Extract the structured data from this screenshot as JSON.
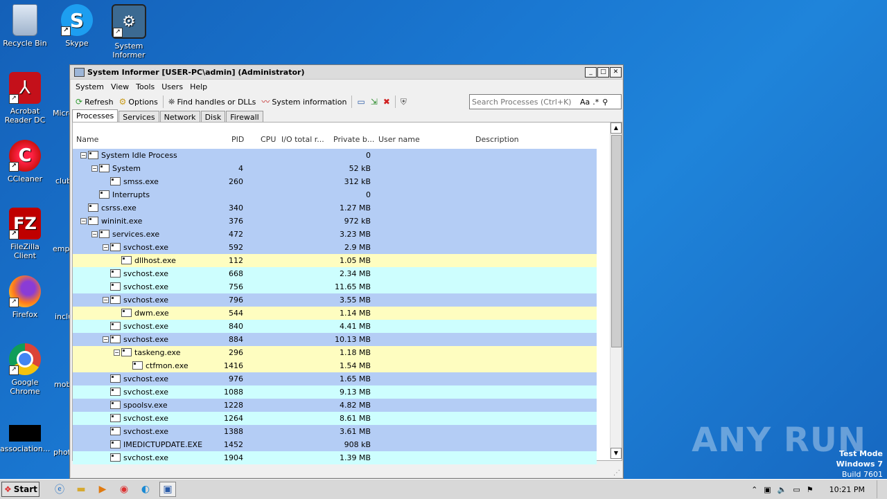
{
  "desktop": {
    "icons": [
      {
        "label": "Recycle Bin",
        "icon": "recycle-bin-icon"
      },
      {
        "label": "Skype",
        "icon": "skype-icon"
      },
      {
        "label": "System Informer",
        "icon": "system-informer-icon"
      },
      {
        "label": "Acrobat Reader DC",
        "icon": "acrobat-icon"
      },
      {
        "label": "CCleaner",
        "icon": "ccleaner-icon"
      },
      {
        "label": "FileZilla Client",
        "icon": "filezilla-icon"
      },
      {
        "label": "Firefox",
        "icon": "firefox-icon"
      },
      {
        "label": "Google Chrome",
        "icon": "chrome-icon"
      },
      {
        "label": "association...",
        "icon": "file-icon"
      }
    ],
    "partial_labels": [
      "Micro",
      "club",
      "emplo",
      "inclu",
      "mobi",
      "phot"
    ],
    "watermark": "ANY RUN",
    "test_mode": [
      "Test Mode",
      "Windows 7",
      "Build 7601"
    ]
  },
  "window": {
    "title": "System Informer [USER-PC\\admin] (Administrator)",
    "controls": {
      "minimize": "_",
      "maximize": "□",
      "close": "✕"
    },
    "menu": [
      "System",
      "View",
      "Tools",
      "Users",
      "Help"
    ],
    "toolbar": {
      "refresh": "Refresh",
      "options": "Options",
      "find_handles": "Find handles or DLLs",
      "system_info": "System information"
    },
    "search": {
      "placeholder": "Search Processes (Ctrl+K)",
      "case": "Aa",
      "regex": ".*"
    },
    "tabs": [
      "Processes",
      "Services",
      "Network",
      "Disk",
      "Firewall"
    ],
    "columns": {
      "name": "Name",
      "pid": "PID",
      "cpu": "CPU",
      "io": "I/O total r...",
      "private": "Private b...",
      "user": "User name",
      "description": "Description"
    },
    "processes": [
      {
        "name": "System Idle Process",
        "pid": "",
        "private": "0",
        "level": 0,
        "toggle": "−",
        "color": "blue"
      },
      {
        "name": "System",
        "pid": "4",
        "private": "52 kB",
        "level": 1,
        "toggle": "−",
        "color": "blue"
      },
      {
        "name": "smss.exe",
        "pid": "260",
        "private": "312 kB",
        "level": 2,
        "toggle": "",
        "color": "blue"
      },
      {
        "name": "Interrupts",
        "pid": "",
        "private": "0",
        "level": 1,
        "toggle": "",
        "color": "blue"
      },
      {
        "name": "csrss.exe",
        "pid": "340",
        "private": "1.27 MB",
        "level": 0,
        "toggle": "",
        "color": "blue"
      },
      {
        "name": "wininit.exe",
        "pid": "376",
        "private": "972 kB",
        "level": 0,
        "toggle": "−",
        "color": "blue"
      },
      {
        "name": "services.exe",
        "pid": "472",
        "private": "3.23 MB",
        "level": 1,
        "toggle": "−",
        "color": "blue"
      },
      {
        "name": "svchost.exe",
        "pid": "592",
        "private": "2.9 MB",
        "level": 2,
        "toggle": "−",
        "color": "blue"
      },
      {
        "name": "dllhost.exe",
        "pid": "112",
        "private": "1.05 MB",
        "level": 3,
        "toggle": "",
        "color": "yellow"
      },
      {
        "name": "svchost.exe",
        "pid": "668",
        "private": "2.34 MB",
        "level": 2,
        "toggle": "",
        "color": "cyan"
      },
      {
        "name": "svchost.exe",
        "pid": "756",
        "private": "11.65 MB",
        "level": 2,
        "toggle": "",
        "color": "cyan"
      },
      {
        "name": "svchost.exe",
        "pid": "796",
        "private": "3.55 MB",
        "level": 2,
        "toggle": "−",
        "color": "blue"
      },
      {
        "name": "dwm.exe",
        "pid": "544",
        "private": "1.14 MB",
        "level": 3,
        "toggle": "",
        "color": "yellow"
      },
      {
        "name": "svchost.exe",
        "pid": "840",
        "private": "4.41 MB",
        "level": 2,
        "toggle": "",
        "color": "cyan"
      },
      {
        "name": "svchost.exe",
        "pid": "884",
        "private": "10.13 MB",
        "level": 2,
        "toggle": "−",
        "color": "blue"
      },
      {
        "name": "taskeng.exe",
        "pid": "296",
        "private": "1.18 MB",
        "level": 3,
        "toggle": "−",
        "color": "yellow"
      },
      {
        "name": "ctfmon.exe",
        "pid": "1416",
        "private": "1.54 MB",
        "level": 4,
        "toggle": "",
        "color": "yellow"
      },
      {
        "name": "svchost.exe",
        "pid": "976",
        "private": "1.65 MB",
        "level": 2,
        "toggle": "",
        "color": "blue"
      },
      {
        "name": "svchost.exe",
        "pid": "1088",
        "private": "9.13 MB",
        "level": 2,
        "toggle": "",
        "color": "cyan"
      },
      {
        "name": "spoolsv.exe",
        "pid": "1228",
        "private": "4.82 MB",
        "level": 2,
        "toggle": "",
        "color": "blue"
      },
      {
        "name": "svchost.exe",
        "pid": "1264",
        "private": "8.61 MB",
        "level": 2,
        "toggle": "",
        "color": "cyan"
      },
      {
        "name": "svchost.exe",
        "pid": "1388",
        "private": "3.61 MB",
        "level": 2,
        "toggle": "",
        "color": "blue"
      },
      {
        "name": "IMEDICTUPDATE.EXE",
        "pid": "1452",
        "private": "908 kB",
        "level": 2,
        "toggle": "",
        "color": "blue"
      },
      {
        "name": "svchost.exe",
        "pid": "1904",
        "private": "1.39 MB",
        "level": 2,
        "toggle": "",
        "color": "cyan"
      }
    ],
    "colors": {
      "blue": "#b4cdf5",
      "cyan": "#cdfefe",
      "yellow": "#fefdc0"
    }
  },
  "taskbar": {
    "start": "Start",
    "clock": "10:21 PM"
  }
}
